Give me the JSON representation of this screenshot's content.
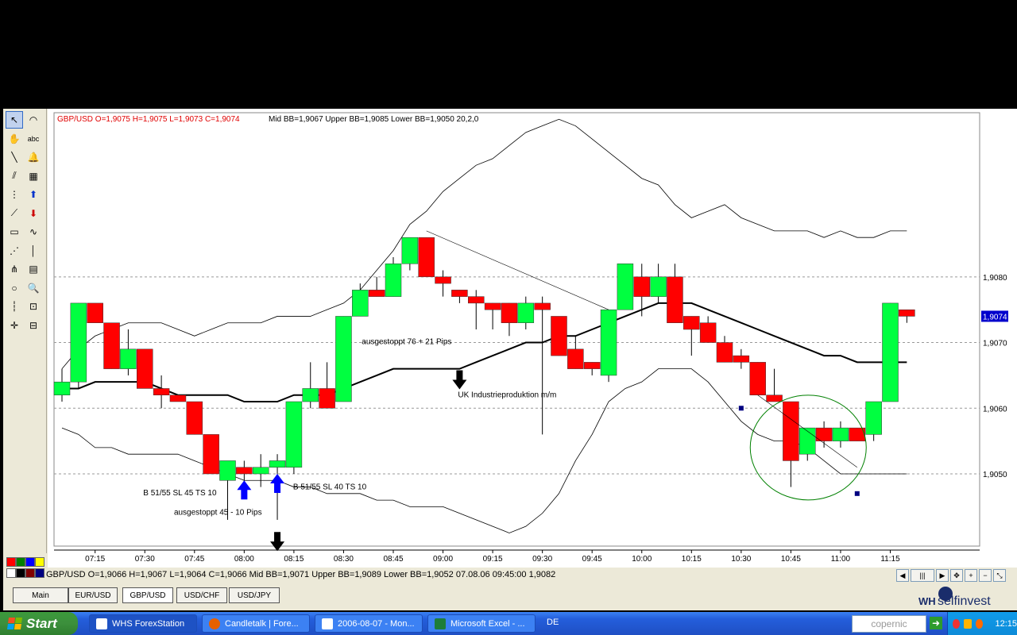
{
  "window": {
    "status_line": "GBP/USD O=1,9066 H=1,9067 L=1,9064 C=1,9066  Mid BB=1,9071 Upper BB=1,9089 Lower BB=1,9052  07.08.06 09:45:00 1,9082"
  },
  "toolbox": {
    "items": [
      {
        "icon": "pointer-icon",
        "glyph": "↖"
      },
      {
        "icon": "sensor-icon",
        "glyph": "◠"
      },
      {
        "icon": "hand-icon",
        "glyph": "✋"
      },
      {
        "icon": "text-tool-icon",
        "glyph": "abc"
      },
      {
        "icon": "line-icon",
        "glyph": "╲"
      },
      {
        "icon": "alarm-bell-icon",
        "glyph": "🔔"
      },
      {
        "icon": "parallel-lines-icon",
        "glyph": "⫽"
      },
      {
        "icon": "calculator-icon",
        "glyph": "▦"
      },
      {
        "icon": "dotted-grid-icon",
        "glyph": "⋮"
      },
      {
        "icon": "buy-arrow-icon",
        "glyph": "⬆"
      },
      {
        "icon": "fan-icon",
        "glyph": "⟋"
      },
      {
        "icon": "sell-arrow-icon",
        "glyph": "⬇"
      },
      {
        "icon": "horizontal-line-icon",
        "glyph": "▭"
      },
      {
        "icon": "wave-icon",
        "glyph": "∿"
      },
      {
        "icon": "gann-fan-icon",
        "glyph": "⋰"
      },
      {
        "icon": "vertical-line-icon",
        "glyph": "│"
      },
      {
        "icon": "pitchfork-icon",
        "glyph": "⋔"
      },
      {
        "icon": "retracement-icon",
        "glyph": "▤"
      },
      {
        "icon": "circle-icon",
        "glyph": "○"
      },
      {
        "icon": "zoom-icon",
        "glyph": "🔍"
      },
      {
        "icon": "fibonacci-icon",
        "glyph": "┆"
      },
      {
        "icon": "zoom-box-icon",
        "glyph": "⊡"
      },
      {
        "icon": "crosshair-icon",
        "glyph": "✛"
      },
      {
        "icon": "zoom-out-icon",
        "glyph": "⊟"
      }
    ],
    "palette": [
      "#ff0000",
      "#008000",
      "#0000ff",
      "#ffff00",
      "#ffffff",
      "#000000",
      "#800000",
      "#000080"
    ]
  },
  "chart_data": {
    "type": "candlestick",
    "header": "GBP/USD O=1,9075 H=1,9075 L=1,9073 C=1,9074",
    "header_bb": "Mid BB=1,9067 Upper BB=1,9085 Lower BB=1,9050  20,2,0",
    "ylim": [
      1.9039,
      1.9105
    ],
    "y_ticks": [
      "1,9080",
      "1,9070",
      "1,9060",
      "1,9050"
    ],
    "y_tick_values": [
      1.908,
      1.907,
      1.906,
      1.905
    ],
    "x_ticks": [
      "07:15",
      "07:30",
      "07:45",
      "08:00",
      "08:15",
      "08:30",
      "08:45",
      "09:00",
      "09:15",
      "09:30",
      "09:45",
      "10:00",
      "10:15",
      "10:30",
      "10:45",
      "11:00",
      "11:15"
    ],
    "x_tick_index": [
      2,
      5,
      8,
      11,
      14,
      17,
      20,
      23,
      26,
      29,
      32,
      35,
      38,
      41,
      44,
      47,
      50
    ],
    "last_price": "1,9074",
    "candles": [
      {
        "o": 1.9062,
        "h": 1.9066,
        "l": 1.9061,
        "c": 1.9064
      },
      {
        "o": 1.9064,
        "h": 1.9076,
        "l": 1.9063,
        "c": 1.9076
      },
      {
        "o": 1.9076,
        "h": 1.9076,
        "l": 1.9073,
        "c": 1.9073
      },
      {
        "o": 1.9073,
        "h": 1.9073,
        "l": 1.9066,
        "c": 1.9066
      },
      {
        "o": 1.9066,
        "h": 1.9072,
        "l": 1.9065,
        "c": 1.9069
      },
      {
        "o": 1.9069,
        "h": 1.9069,
        "l": 1.9063,
        "c": 1.9063
      },
      {
        "o": 1.9063,
        "h": 1.9065,
        "l": 1.906,
        "c": 1.9062
      },
      {
        "o": 1.9062,
        "h": 1.9062,
        "l": 1.9061,
        "c": 1.9061
      },
      {
        "o": 1.9061,
        "h": 1.9061,
        "l": 1.9056,
        "c": 1.9056
      },
      {
        "o": 1.9056,
        "h": 1.9056,
        "l": 1.905,
        "c": 1.905
      },
      {
        "o": 1.9049,
        "h": 1.9052,
        "l": 1.9043,
        "c": 1.9052
      },
      {
        "o": 1.9051,
        "h": 1.9052,
        "l": 1.9048,
        "c": 1.905
      },
      {
        "o": 1.905,
        "h": 1.9053,
        "l": 1.9048,
        "c": 1.9051
      },
      {
        "o": 1.9051,
        "h": 1.9053,
        "l": 1.9043,
        "c": 1.9052
      },
      {
        "o": 1.9051,
        "h": 1.9061,
        "l": 1.905,
        "c": 1.9061
      },
      {
        "o": 1.9061,
        "h": 1.9067,
        "l": 1.906,
        "c": 1.9063
      },
      {
        "o": 1.9063,
        "h": 1.9067,
        "l": 1.906,
        "c": 1.906
      },
      {
        "o": 1.9061,
        "h": 1.9074,
        "l": 1.9061,
        "c": 1.9074
      },
      {
        "o": 1.9074,
        "h": 1.9079,
        "l": 1.9074,
        "c": 1.9078
      },
      {
        "o": 1.9078,
        "h": 1.908,
        "l": 1.9077,
        "c": 1.9077
      },
      {
        "o": 1.9077,
        "h": 1.9083,
        "l": 1.9077,
        "c": 1.9082
      },
      {
        "o": 1.9082,
        "h": 1.9086,
        "l": 1.9081,
        "c": 1.9086
      },
      {
        "o": 1.9086,
        "h": 1.9086,
        "l": 1.908,
        "c": 1.908
      },
      {
        "o": 1.908,
        "h": 1.9081,
        "l": 1.9077,
        "c": 1.9079
      },
      {
        "o": 1.9078,
        "h": 1.9078,
        "l": 1.9076,
        "c": 1.9077
      },
      {
        "o": 1.9077,
        "h": 1.9078,
        "l": 1.9072,
        "c": 1.9076
      },
      {
        "o": 1.9076,
        "h": 1.9076,
        "l": 1.9072,
        "c": 1.9075
      },
      {
        "o": 1.9076,
        "h": 1.9076,
        "l": 1.9071,
        "c": 1.9073
      },
      {
        "o": 1.9073,
        "h": 1.9077,
        "l": 1.9072,
        "c": 1.9076
      },
      {
        "o": 1.9076,
        "h": 1.9077,
        "l": 1.9056,
        "c": 1.9075
      },
      {
        "o": 1.9074,
        "h": 1.9074,
        "l": 1.9068,
        "c": 1.9068
      },
      {
        "o": 1.9069,
        "h": 1.9071,
        "l": 1.9066,
        "c": 1.9066
      },
      {
        "o": 1.9067,
        "h": 1.9067,
        "l": 1.9065,
        "c": 1.9066
      },
      {
        "o": 1.9065,
        "h": 1.9075,
        "l": 1.9064,
        "c": 1.9075
      },
      {
        "o": 1.9075,
        "h": 1.9082,
        "l": 1.9075,
        "c": 1.9082
      },
      {
        "o": 1.908,
        "h": 1.9082,
        "l": 1.9074,
        "c": 1.9077
      },
      {
        "o": 1.9077,
        "h": 1.9082,
        "l": 1.9076,
        "c": 1.908
      },
      {
        "o": 1.908,
        "h": 1.9082,
        "l": 1.9073,
        "c": 1.9073
      },
      {
        "o": 1.9074,
        "h": 1.9074,
        "l": 1.9068,
        "c": 1.9072
      },
      {
        "o": 1.9073,
        "h": 1.9074,
        "l": 1.907,
        "c": 1.907
      },
      {
        "o": 1.907,
        "h": 1.9071,
        "l": 1.9067,
        "c": 1.9067
      },
      {
        "o": 1.9068,
        "h": 1.9069,
        "l": 1.9066,
        "c": 1.9067
      },
      {
        "o": 1.9067,
        "h": 1.9067,
        "l": 1.9062,
        "c": 1.9062
      },
      {
        "o": 1.9062,
        "h": 1.9066,
        "l": 1.9061,
        "c": 1.9061
      },
      {
        "o": 1.9061,
        "h": 1.9061,
        "l": 1.9048,
        "c": 1.9052
      },
      {
        "o": 1.9053,
        "h": 1.9057,
        "l": 1.9052,
        "c": 1.9057
      },
      {
        "o": 1.9057,
        "h": 1.9058,
        "l": 1.9054,
        "c": 1.9055
      },
      {
        "o": 1.9055,
        "h": 1.9058,
        "l": 1.9054,
        "c": 1.9057
      },
      {
        "o": 1.9057,
        "h": 1.9057,
        "l": 1.9055,
        "c": 1.9055
      },
      {
        "o": 1.9056,
        "h": 1.9061,
        "l": 1.9055,
        "c": 1.9061
      },
      {
        "o": 1.9061,
        "h": 1.9076,
        "l": 1.9061,
        "c": 1.9076
      },
      {
        "o": 1.9075,
        "h": 1.9075,
        "l": 1.9073,
        "c": 1.9074
      }
    ],
    "upper_bb": [
      1.9066,
      1.9069,
      1.9071,
      1.9072,
      1.9073,
      1.9073,
      1.9073,
      1.9072,
      1.9071,
      1.9072,
      1.9073,
      1.9073,
      1.9073,
      1.9074,
      1.9074,
      1.9074,
      1.9075,
      1.9076,
      1.9078,
      1.9081,
      1.9084,
      1.9088,
      1.909,
      1.9093,
      1.9095,
      1.9097,
      1.9098,
      1.91,
      1.9102,
      1.9103,
      1.9104,
      1.9103,
      1.9101,
      1.9099,
      1.9097,
      1.9095,
      1.9094,
      1.9091,
      1.9089,
      1.909,
      1.9091,
      1.9089,
      1.9088,
      1.9087,
      1.9087,
      1.9087,
      1.9086,
      1.9087,
      1.9086,
      1.9086,
      1.9087,
      1.9087
    ],
    "mid_bb": [
      1.9063,
      1.9063,
      1.9064,
      1.9064,
      1.9064,
      1.9064,
      1.9063,
      1.9062,
      1.9062,
      1.9062,
      1.9062,
      1.9061,
      1.9061,
      1.9061,
      1.9062,
      1.9062,
      1.9062,
      1.9063,
      1.9064,
      1.9065,
      1.9066,
      1.9066,
      1.9066,
      1.9066,
      1.9066,
      1.9067,
      1.9068,
      1.9069,
      1.907,
      1.907,
      1.9071,
      1.9071,
      1.9072,
      1.9073,
      1.9074,
      1.9075,
      1.9076,
      1.9076,
      1.9076,
      1.9075,
      1.9074,
      1.9073,
      1.9072,
      1.9071,
      1.907,
      1.9069,
      1.9068,
      1.9068,
      1.9067,
      1.9067,
      1.9067,
      1.9067
    ],
    "lower_bb": [
      1.9057,
      1.9056,
      1.9054,
      1.9054,
      1.9053,
      1.9053,
      1.9053,
      1.9053,
      1.9052,
      1.9051,
      1.905,
      1.9049,
      1.9049,
      1.9049,
      1.9048,
      1.9048,
      1.9047,
      1.9047,
      1.9047,
      1.9046,
      1.9046,
      1.9045,
      1.9045,
      1.9045,
      1.9044,
      1.9043,
      1.9042,
      1.9041,
      1.9042,
      1.9044,
      1.9047,
      1.9052,
      1.9056,
      1.9061,
      1.9063,
      1.9064,
      1.9066,
      1.9066,
      1.9066,
      1.9064,
      1.9061,
      1.9058,
      1.9056,
      1.9055,
      1.9055,
      1.9054,
      1.9052,
      1.905,
      1.905,
      1.905,
      1.905,
      1.905
    ],
    "annotations": [
      "ausgestoppt 76 + 21 Pips",
      "UK Industrieproduktion m/m",
      "B 51/55 SL 45 TS 10",
      "B 51/55 SL 40 TS 10",
      "ausgestoppt 45 - 10 Pips"
    ],
    "grid": "horizontal dashed"
  },
  "tabs": [
    {
      "label": "Main",
      "active": false
    },
    {
      "label": "EUR/USD",
      "active": false
    },
    {
      "label": "GBP/USD",
      "active": true
    },
    {
      "label": "USD/CHF",
      "active": false
    },
    {
      "label": "USD/JPY",
      "active": false
    }
  ],
  "logo": {
    "wh": "WH",
    "rest": "selfinvest"
  },
  "taskbar": {
    "start": "Start",
    "tasks": [
      {
        "label": "WHS ForexStation",
        "icon": "app-window-icon",
        "active": true
      },
      {
        "label": "Candletalk | Fore...",
        "icon": "firefox-icon",
        "active": false
      },
      {
        "label": "2006-08-07 - Mon...",
        "icon": "document-icon",
        "active": false
      },
      {
        "label": "Microsoft Excel - ...",
        "icon": "excel-icon",
        "active": false
      }
    ],
    "lang": "DE",
    "search_placeholder": "copernic",
    "clock": "12:15"
  }
}
